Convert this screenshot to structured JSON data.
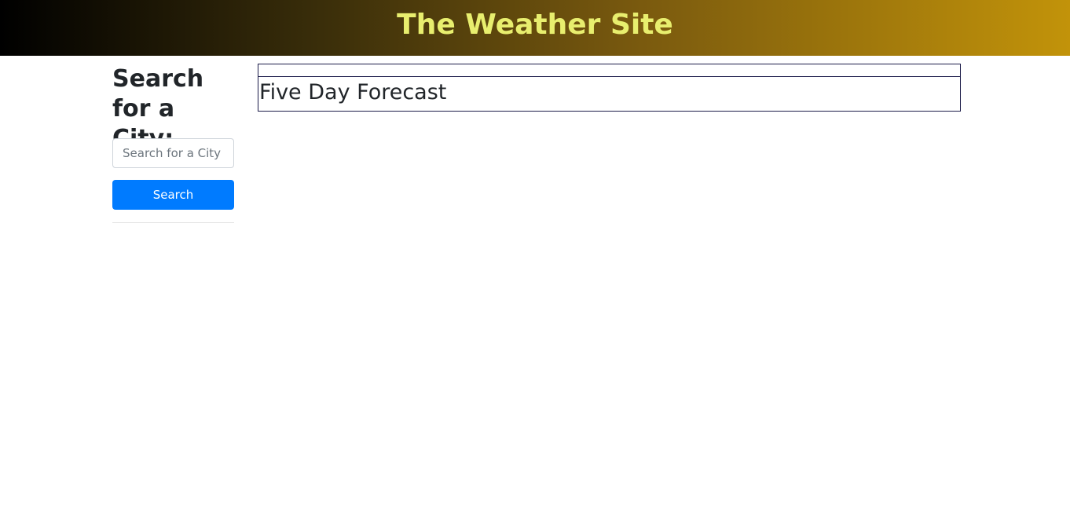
{
  "header": {
    "title": "The Weather Site"
  },
  "sidebar": {
    "heading": "Search for a City:",
    "search_placeholder": "Search for a City",
    "search_value": "",
    "search_button_label": "Search"
  },
  "main": {
    "forecast_heading": "Five Day Forecast"
  },
  "colors": {
    "header_gradient_start": "#000000",
    "header_gradient_end": "#c2930a",
    "title_color": "#e8ee6e",
    "button_color": "#007bff",
    "box_border_color": "#1c1c4a"
  }
}
